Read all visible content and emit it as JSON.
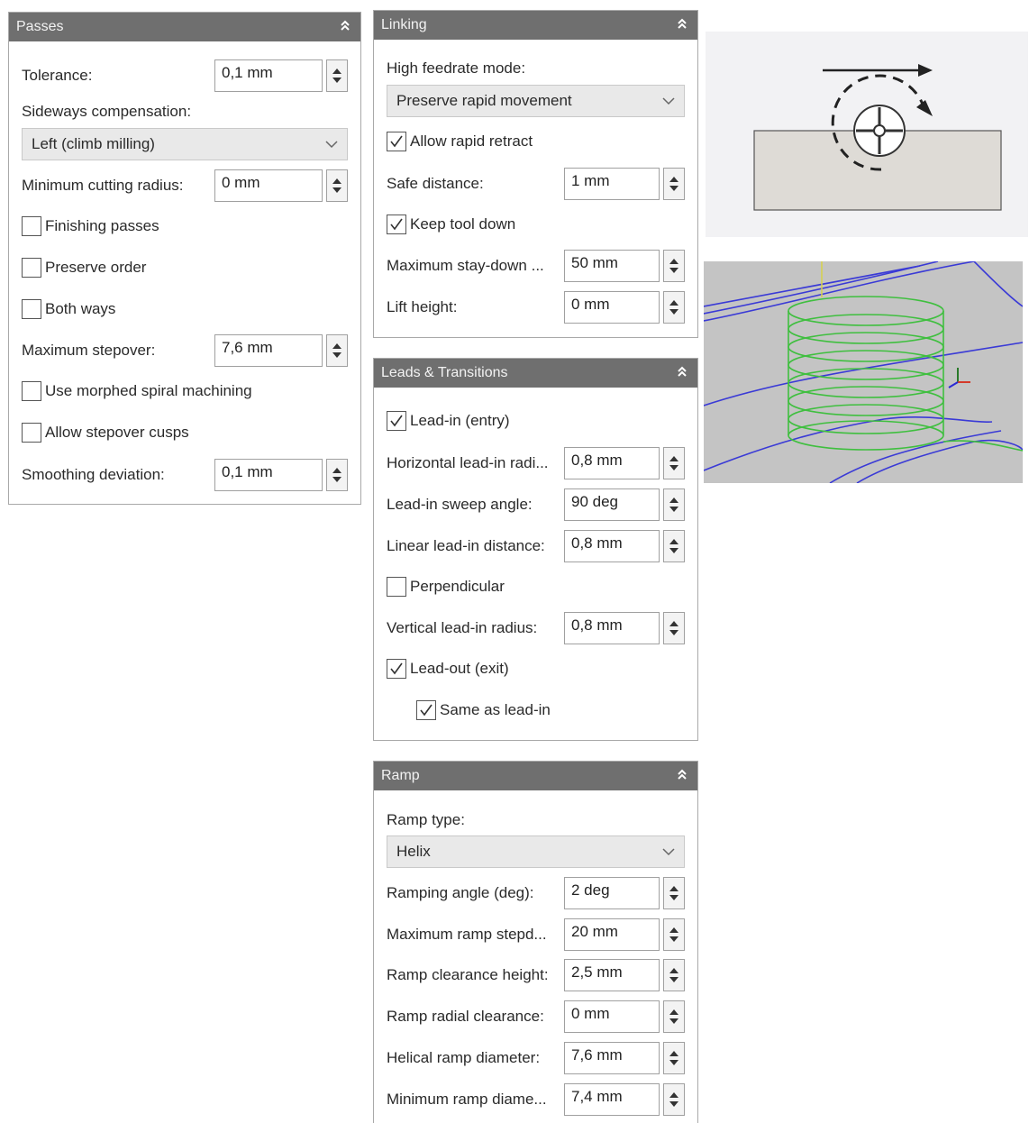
{
  "passes": {
    "title": "Passes",
    "tolerance_label": "Tolerance:",
    "tolerance_value": "0,1 mm",
    "sideways_label": "Sideways compensation:",
    "sideways_value": "Left (climb milling)",
    "min_cutting_radius_label": "Minimum cutting radius:",
    "min_cutting_radius_value": "0 mm",
    "finishing_passes_label": "Finishing passes",
    "finishing_passes_checked": false,
    "preserve_order_label": "Preserve order",
    "preserve_order_checked": false,
    "both_ways_label": "Both ways",
    "both_ways_checked": false,
    "max_stepover_label": "Maximum stepover:",
    "max_stepover_value": "7,6 mm",
    "morphed_spiral_label": "Use morphed spiral machining",
    "morphed_spiral_checked": false,
    "stepover_cusps_label": "Allow stepover cusps",
    "stepover_cusps_checked": false,
    "smoothing_label": "Smoothing deviation:",
    "smoothing_value": "0,1 mm"
  },
  "linking": {
    "title": "Linking",
    "high_feedrate_label": "High feedrate mode:",
    "high_feedrate_value": "Preserve rapid movement",
    "allow_rapid_retract_label": "Allow rapid retract",
    "allow_rapid_retract_checked": true,
    "safe_distance_label": "Safe distance:",
    "safe_distance_value": "1 mm",
    "keep_tool_down_label": "Keep tool down",
    "keep_tool_down_checked": true,
    "max_stay_down_label": "Maximum stay-down ...",
    "max_stay_down_value": "50 mm",
    "lift_height_label": "Lift height:",
    "lift_height_value": "0 mm"
  },
  "leads": {
    "title": "Leads & Transitions",
    "lead_in_label": "Lead-in (entry)",
    "lead_in_checked": true,
    "horiz_radius_label": "Horizontal lead-in radi...",
    "horiz_radius_value": "0,8 mm",
    "sweep_angle_label": "Lead-in sweep angle:",
    "sweep_angle_value": "90 deg",
    "linear_distance_label": "Linear lead-in distance:",
    "linear_distance_value": "0,8 mm",
    "perpendicular_label": "Perpendicular",
    "perpendicular_checked": false,
    "vertical_radius_label": "Vertical lead-in radius:",
    "vertical_radius_value": "0,8 mm",
    "lead_out_label": "Lead-out (exit)",
    "lead_out_checked": true,
    "same_as_lead_in_label": "Same as lead-in",
    "same_as_lead_in_checked": true
  },
  "ramp": {
    "title": "Ramp",
    "ramp_type_label": "Ramp type:",
    "ramp_type_value": "Helix",
    "ramping_angle_label": "Ramping angle (deg):",
    "ramping_angle_value": "2 deg",
    "max_stepdown_label": "Maximum ramp stepd...",
    "max_stepdown_value": "20 mm",
    "clearance_height_label": "Ramp clearance height:",
    "clearance_height_value": "2,5 mm",
    "radial_clearance_label": "Ramp radial clearance:",
    "radial_clearance_value": "0 mm",
    "helical_diameter_label": "Helical ramp diameter:",
    "helical_diameter_value": "7,6 mm",
    "min_diameter_label": "Minimum ramp diame...",
    "min_diameter_value": "7,4 mm"
  },
  "icons": {
    "collapse": "double-chevron-up-icon",
    "spin": "spin-arrows-icon",
    "dropdown": "chevron-down-icon",
    "check": "checkmark-icon"
  },
  "colors": {
    "header_bg": "#6f6f6f",
    "viewport_bg": "#c4c4c4",
    "toolpath_blue": "#3a3ad6",
    "helix_green": "#3fbf3f"
  }
}
